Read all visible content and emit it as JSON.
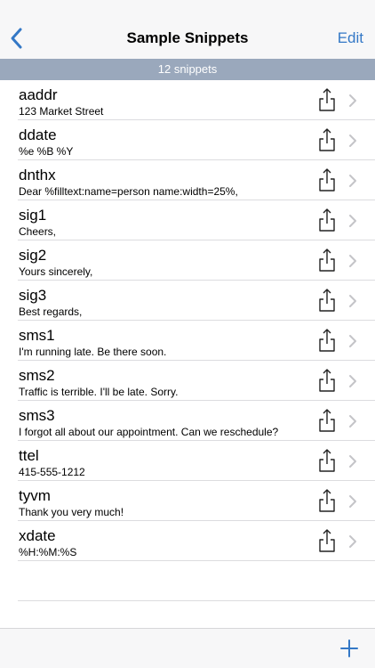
{
  "nav": {
    "title": "Sample Snippets",
    "edit_label": "Edit",
    "back_icon": "chevron-left-icon"
  },
  "count_label": "12 snippets",
  "snippets": [
    {
      "name": "aaddr",
      "text": "123 Market Street"
    },
    {
      "name": "ddate",
      "text": "%e %B %Y"
    },
    {
      "name": "dnthx",
      "text": "Dear %filltext:name=person name:width=25%,"
    },
    {
      "name": "sig1",
      "text": "Cheers,"
    },
    {
      "name": "sig2",
      "text": "Yours sincerely,"
    },
    {
      "name": "sig3",
      "text": "Best regards,"
    },
    {
      "name": "sms1",
      "text": "I'm running late. Be there soon."
    },
    {
      "name": "sms2",
      "text": "Traffic is terrible. I'll be late. Sorry."
    },
    {
      "name": "sms3",
      "text": "I forgot all about our appointment. Can we reschedule?"
    },
    {
      "name": "ttel",
      "text": "415-555-1212"
    },
    {
      "name": "tyvm",
      "text": "Thank you very much!"
    },
    {
      "name": "xdate",
      "text": "%H:%M:%S"
    }
  ],
  "colors": {
    "accent": "#3478c6",
    "count_bar": "#9aa8bc",
    "bar_bg": "#f7f7f8"
  },
  "toolbar": {
    "add_icon": "plus-icon"
  }
}
